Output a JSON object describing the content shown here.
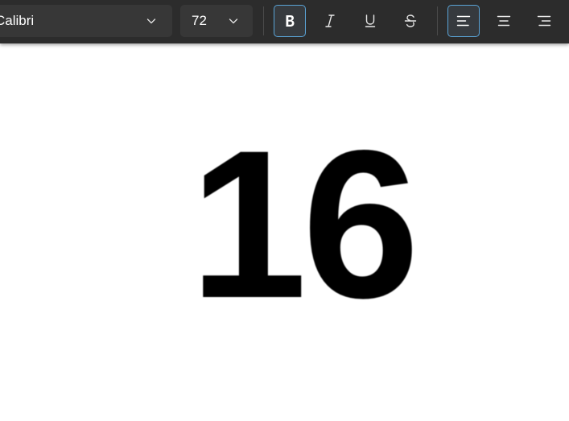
{
  "toolbar": {
    "font_family": "Calibri",
    "font_size": "72",
    "bold_active": true,
    "align_left_active": true
  },
  "icons": {
    "font_dropdown": "chevron-down-icon",
    "size_dropdown": "chevron-down-icon",
    "bold": "bold-icon",
    "italic": "italic-icon",
    "underline": "underline-icon",
    "strikethrough": "strikethrough-icon",
    "align_left": "align-left-icon",
    "align_center": "align-center-icon",
    "align_right": "align-right-icon"
  },
  "colors": {
    "toolbar_bg": "#2c2c2c",
    "control_bg": "#373737",
    "accent": "#5aa3d6",
    "canvas_bg": "#ffffff",
    "text": "#000000"
  },
  "document": {
    "text": "16"
  }
}
